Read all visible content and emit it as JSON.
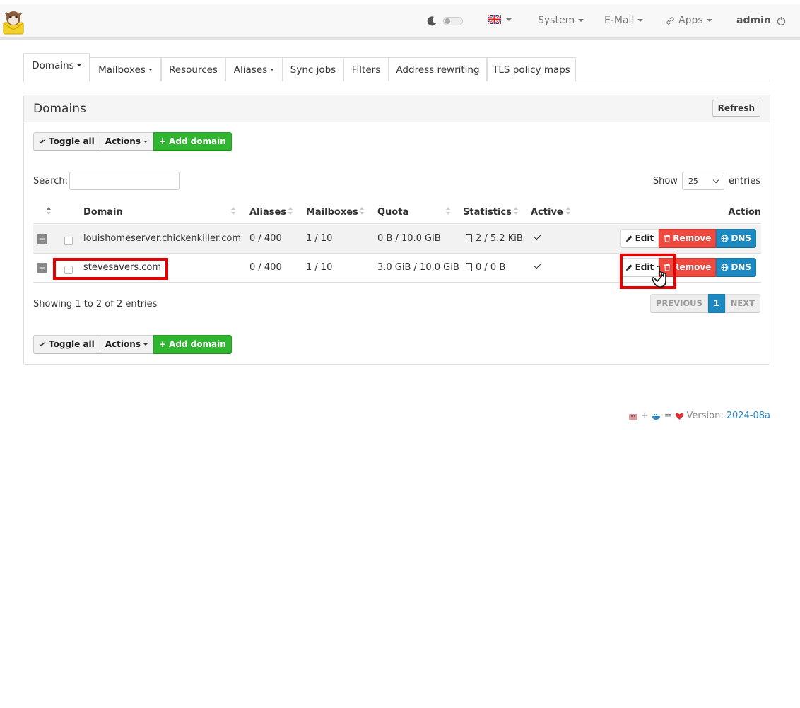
{
  "topbar": {
    "menus": [
      {
        "label": "System"
      },
      {
        "label": "E-Mail"
      },
      {
        "label": "Apps"
      }
    ],
    "user": "admin"
  },
  "tabs": [
    {
      "label": "Domains",
      "active": true
    },
    {
      "label": "Mailboxes"
    },
    {
      "label": "Resources"
    },
    {
      "label": "Aliases"
    },
    {
      "label": "Sync jobs"
    },
    {
      "label": "Filters"
    },
    {
      "label": "Address rewriting"
    },
    {
      "label": "TLS policy maps"
    }
  ],
  "panel": {
    "title": "Domains",
    "refresh_label": "Refresh",
    "toolbar": {
      "toggle_all": "Toggle all",
      "actions": "Actions",
      "add_domain": "Add domain"
    },
    "search_label": "Search:",
    "search_value": "",
    "show_label": "Show",
    "page_size": "25",
    "entries_label": "entries"
  },
  "table": {
    "headers": {
      "domain": "Domain",
      "aliases": "Aliases",
      "mailboxes": "Mailboxes",
      "quota": "Quota",
      "statistics": "Statistics",
      "active": "Active",
      "action": "Action"
    },
    "rows": [
      {
        "domain": "louishomeserver.chickenkiller.com",
        "aliases": "0 / 400",
        "mailboxes": "1 / 10",
        "quota": "0 B / 10.0 GiB",
        "statistics": "2 / 5.2 KiB"
      },
      {
        "domain": "stevesavers.com",
        "aliases": "0 / 400",
        "mailboxes": "1 / 10",
        "quota": "3.0 GiB / 10.0 GiB",
        "statistics": "0 / 0 B"
      }
    ],
    "action_labels": {
      "edit": "Edit",
      "remove": "Remove",
      "dns": "DNS"
    }
  },
  "pagination": {
    "summary": "Showing 1 to 2 of 2 entries",
    "previous": "PREVIOUS",
    "current_page": "1",
    "next": "NEXT"
  },
  "footer": {
    "version_label": "Version:",
    "version": "2024-08a"
  },
  "colors": {
    "accent_blue": "#1c89c0",
    "add_green": "#2fb52f",
    "remove_red": "#ee4a3f",
    "highlight_red": "#e60000"
  },
  "icons": [
    "cow-logo-icon",
    "moon-icon",
    "uk-flag-icon",
    "link-icon",
    "power-icon",
    "pencil-icon",
    "trash-icon",
    "globe-icon",
    "documents-icon",
    "checkmark-icon",
    "plus-icon",
    "hand-cursor-icon"
  ]
}
